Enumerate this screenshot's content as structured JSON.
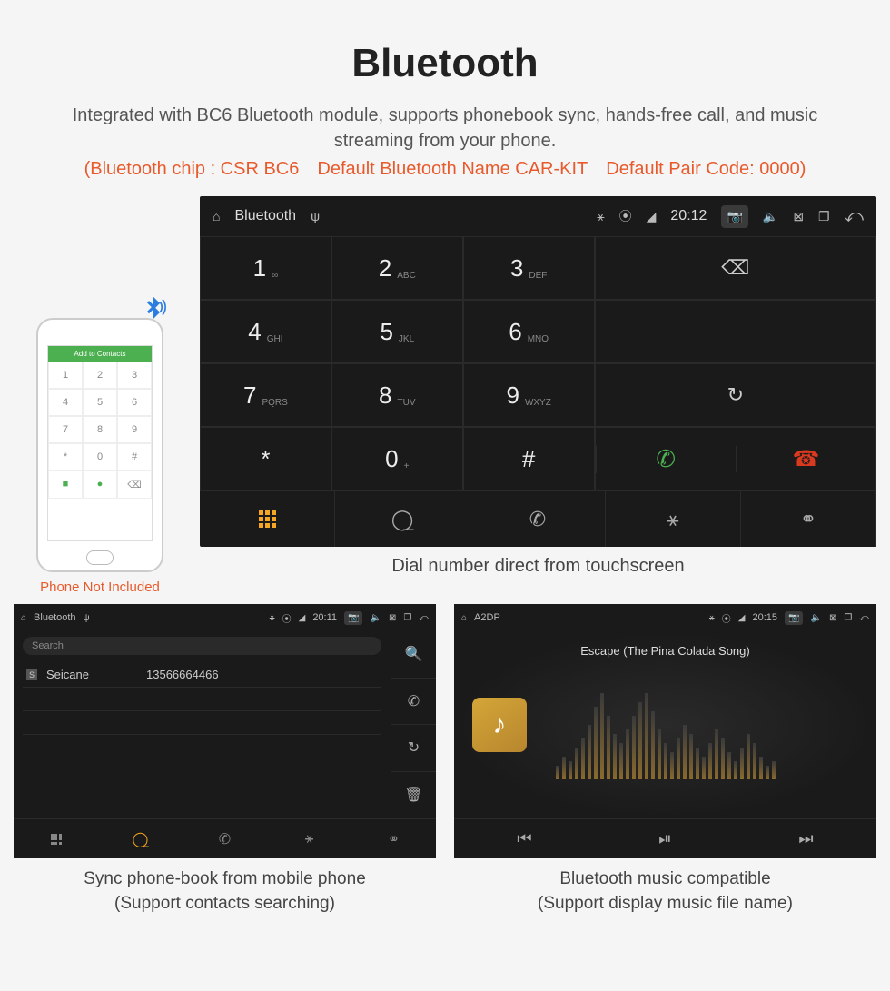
{
  "header": {
    "title": "Bluetooth",
    "subtitle": "Integrated with BC6 Bluetooth module, supports phonebook sync, hands-free call, and music streaming from your phone.",
    "specs": "(Bluetooth chip : CSR BC6 Default Bluetooth Name CAR-KIT Default Pair Code: 0000)"
  },
  "phone": {
    "header": "Add to Contacts",
    "note": "Phone Not Included"
  },
  "dialer": {
    "bar_title": "Bluetooth",
    "time": "20:12",
    "keys": [
      {
        "num": "1",
        "sub": "∞"
      },
      {
        "num": "2",
        "sub": "ABC"
      },
      {
        "num": "3",
        "sub": "DEF"
      },
      {
        "num": "4",
        "sub": "GHI"
      },
      {
        "num": "5",
        "sub": "JKL"
      },
      {
        "num": "6",
        "sub": "MNO"
      },
      {
        "num": "7",
        "sub": "PQRS"
      },
      {
        "num": "8",
        "sub": "TUV"
      },
      {
        "num": "9",
        "sub": "WXYZ"
      },
      {
        "num": "*",
        "sub": ""
      },
      {
        "num": "0",
        "sub": "+"
      },
      {
        "num": "#",
        "sub": ""
      }
    ],
    "caption": "Dial number direct from touchscreen"
  },
  "contacts": {
    "bar_title": "Bluetooth",
    "time": "20:11",
    "search": "Search",
    "row_name": "Seicane",
    "row_num": "13566664466",
    "caption1": "Sync phone-book from mobile phone",
    "caption2": "(Support contacts searching)"
  },
  "music": {
    "bar_title": "A2DP",
    "time": "20:15",
    "song": "Escape (The Pina Colada Song)",
    "caption1": "Bluetooth music compatible",
    "caption2": "(Support display music file name)"
  }
}
